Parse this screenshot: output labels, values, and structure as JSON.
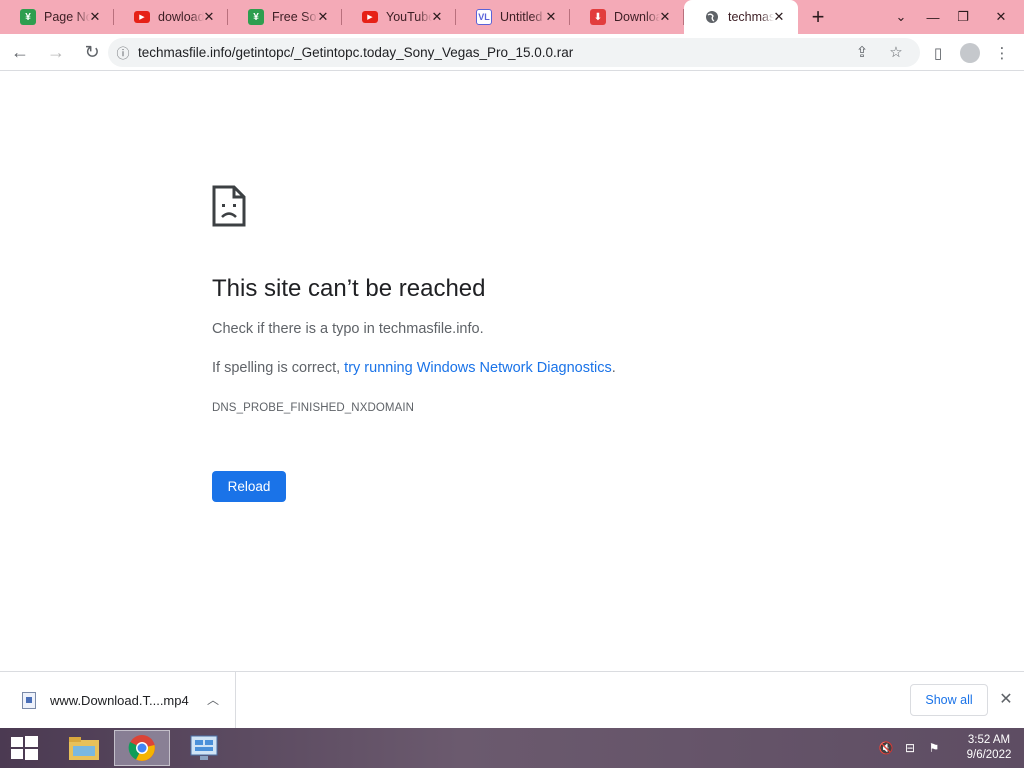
{
  "tabs": [
    {
      "title": "Page Not Found",
      "favicon": "green-square-icon",
      "color": "#2e9e4f",
      "active": false
    },
    {
      "title": "dowload",
      "favicon": "youtube-icon",
      "color": "#e62117",
      "active": false
    },
    {
      "title": "Free Software",
      "favicon": "green-square-icon",
      "color": "#2e9e4f",
      "active": false
    },
    {
      "title": "YouTube",
      "favicon": "youtube-icon",
      "color": "#e62117",
      "active": false
    },
    {
      "title": "Untitled",
      "favicon": "document-icon",
      "color": "#5a63d8",
      "active": false
    },
    {
      "title": "Download",
      "favicon": "download-icon",
      "color": "#e23d3d",
      "active": false
    },
    {
      "title": "techmasfile",
      "favicon": "globe-icon",
      "color": "#5f6368",
      "active": true
    }
  ],
  "toolbar": {
    "url": "techmasfile.info/getintopc/_Getintopc.today_Sony_Vegas_Pro_15.0.0.rar"
  },
  "error": {
    "title": "This site can’t be reached",
    "line1": "Check if there is a typo in techmasfile.info.",
    "line2_prefix": "If spelling is correct, ",
    "line2_link": "try running Windows Network Diagnostics",
    "line2_suffix": ".",
    "code": "DNS_PROBE_FINISHED_NXDOMAIN",
    "reload_label": "Reload"
  },
  "download_bar": {
    "filename": "www.Download.T....mp4",
    "show_all_label": "Show all"
  },
  "taskbar": {
    "time": "3:52 AM",
    "date": "9/6/2022"
  }
}
